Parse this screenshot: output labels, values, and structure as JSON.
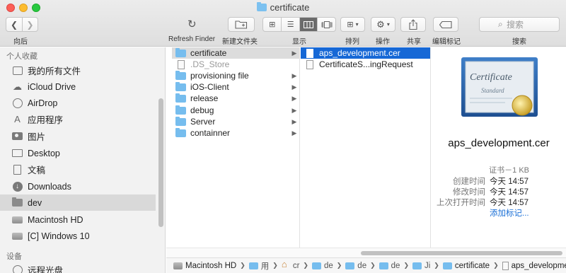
{
  "window": {
    "title": "certificate"
  },
  "toolbar": {
    "back_label": "向后",
    "refresh_label": "Refresh Finder",
    "new_folder_label": "新建文件夹",
    "view_label": "显示",
    "arrange_label": "排列",
    "action_label": "操作",
    "share_label": "共享",
    "tag_label": "编辑标记",
    "search_label": "搜索",
    "search_placeholder": "搜索"
  },
  "sidebar": {
    "favorites_header": "个人收藏",
    "items": [
      {
        "label": "我的所有文件",
        "icon": "all-files-icon"
      },
      {
        "label": "iCloud Drive",
        "icon": "icloud-icon"
      },
      {
        "label": "AirDrop",
        "icon": "airdrop-icon"
      },
      {
        "label": "应用程序",
        "icon": "applications-icon"
      },
      {
        "label": "图片",
        "icon": "pictures-icon"
      },
      {
        "label": "Desktop",
        "icon": "desktop-icon"
      },
      {
        "label": "文稿",
        "icon": "documents-icon"
      },
      {
        "label": "Downloads",
        "icon": "downloads-icon"
      },
      {
        "label": "dev",
        "icon": "folder-icon",
        "selected": true
      },
      {
        "label": "Macintosh HD",
        "icon": "hard-drive-icon"
      },
      {
        "label": "[C] Windows 10",
        "icon": "hard-drive-icon"
      }
    ],
    "devices_header": "设备",
    "devices": [
      {
        "label": "远程光盘",
        "icon": "remote-disc-icon"
      }
    ]
  },
  "column1": [
    {
      "name": "certificate",
      "type": "folder",
      "has_children": true,
      "selected": true
    },
    {
      "name": ".DS_Store",
      "type": "file",
      "dim": true
    },
    {
      "name": "provisioning file",
      "type": "folder",
      "has_children": true
    },
    {
      "name": "iOS-Client",
      "type": "folder",
      "has_children": true
    },
    {
      "name": "release",
      "type": "folder",
      "has_children": true
    },
    {
      "name": "debug",
      "type": "folder",
      "has_children": true
    },
    {
      "name": "Server",
      "type": "folder",
      "has_children": true
    },
    {
      "name": "containner",
      "type": "folder",
      "has_children": true
    }
  ],
  "column2": [
    {
      "name": "aps_development.cer",
      "type": "file",
      "selected": true
    },
    {
      "name": "CertificateS...ingRequest",
      "type": "file"
    }
  ],
  "preview": {
    "image_text_1": "Certificate",
    "image_text_2": "Standard",
    "file_name": "aps_development.cer",
    "kind_size": "证书－1 KB",
    "created_label": "创建时间",
    "created_value": "今天 14:57",
    "modified_label": "修改时间",
    "modified_value": "今天 14:57",
    "opened_label": "上次打开时间",
    "opened_value": "今天 14:57",
    "add_tag_link": "添加标记..."
  },
  "pathbar": [
    {
      "label": "Macintosh HD",
      "icon": "hd"
    },
    {
      "label": "用",
      "icon": "folder"
    },
    {
      "label": "cr",
      "icon": "home"
    },
    {
      "label": "de",
      "icon": "folder"
    },
    {
      "label": "de",
      "icon": "folder"
    },
    {
      "label": "de",
      "icon": "folder"
    },
    {
      "label": "Ji",
      "icon": "folder"
    },
    {
      "label": "certificate",
      "icon": "folder"
    },
    {
      "label": "aps_development.cer",
      "icon": "doc"
    }
  ],
  "colors": {
    "selection_blue": "#1668d6",
    "folder_blue": "#76bdee",
    "link_blue": "#1a6fd6"
  }
}
